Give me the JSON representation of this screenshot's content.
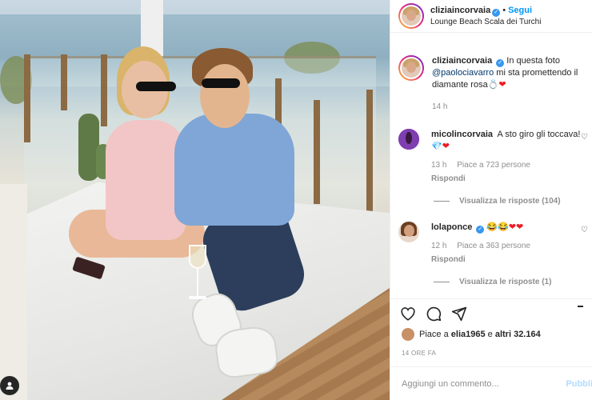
{
  "post": {
    "username": "cliziaincorvaia",
    "follow_label": "Segui",
    "location": "Lounge Beach Scala dei Turchi",
    "caption_user": "cliziaincorvaia",
    "caption_prefix": "In questa foto",
    "caption_mention": "@paolociavarro",
    "caption_suffix": "mi sta promettendo il diamante rosa",
    "caption_time": "14 h"
  },
  "comments": [
    {
      "username": "micolincorvaia",
      "text": "A sto giro gli toccava!",
      "time": "13 h",
      "likes": "Piace a 723 persone",
      "reply_label": "Rispondi",
      "view_replies": "Visualizza le risposte (104)"
    },
    {
      "username": "lolaponce",
      "text": "",
      "time": "12 h",
      "likes": "Piace a 363 persone",
      "reply_label": "Rispondi",
      "view_replies": "Visualizza le risposte (1)"
    }
  ],
  "footer": {
    "likes_prefix": "Piace a",
    "likes_user": "elia1965",
    "likes_mid": "e",
    "likes_others": "altri 32.164",
    "time_ago": "14 ORE FA",
    "comment_placeholder": "Aggiungi un commento...",
    "publish_label": "Pubbli"
  },
  "icons": {
    "verified": "verified-badge-icon",
    "like": "heart-icon",
    "comment": "comment-icon",
    "share": "paper-plane-icon",
    "save": "bookmark-icon",
    "user_tag": "user-tag-icon"
  },
  "colors": {
    "link": "#0095f6",
    "verified": "#3897f0",
    "mention": "#00376b",
    "muted": "#8e8e8e"
  }
}
